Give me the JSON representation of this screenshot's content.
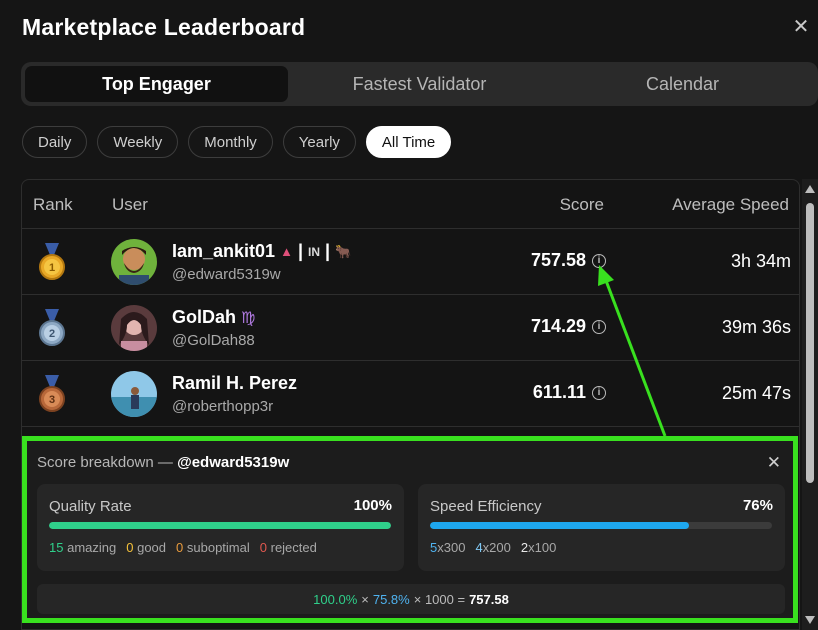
{
  "header": {
    "title": "Marketplace Leaderboard",
    "close_icon": "close-icon"
  },
  "tabs": [
    {
      "label": "Top Engager",
      "active": true
    },
    {
      "label": "Fastest Validator",
      "active": false
    },
    {
      "label": "Calendar",
      "active": false
    }
  ],
  "periods": [
    {
      "label": "Daily",
      "active": false
    },
    {
      "label": "Weekly",
      "active": false
    },
    {
      "label": "Monthly",
      "active": false
    },
    {
      "label": "Yearly",
      "active": false
    },
    {
      "label": "All Time",
      "active": true
    }
  ],
  "table": {
    "headers": {
      "rank": "Rank",
      "user": "User",
      "score": "Score",
      "speed": "Average Speed"
    },
    "rows": [
      {
        "rank": 1,
        "medal": "gold-medal",
        "name": "Iam_ankit01",
        "extra": "▲ | IN | 🐂",
        "handle": "@edward5319w",
        "score": "757.58",
        "speed": "3h 34m"
      },
      {
        "rank": 2,
        "medal": "silver-medal",
        "name": "GolDah",
        "extra": "♍",
        "handle": "@GolDah88",
        "score": "714.29",
        "speed": "39m 36s"
      },
      {
        "rank": 3,
        "medal": "bronze-medal",
        "name": "Ramil H. Perez",
        "extra": "",
        "handle": "@roberthopp3r",
        "score": "611.11",
        "speed": "25m 47s"
      }
    ]
  },
  "breakdown": {
    "title_prefix": "Score breakdown —",
    "user": "@edward5319w",
    "quality": {
      "label": "Quality Rate",
      "value": "100%",
      "fraction": 1.0,
      "color": "#2fcf8a",
      "stats": [
        {
          "num": "15",
          "label": "amazing"
        },
        {
          "num": "0",
          "label": "good"
        },
        {
          "num": "0",
          "label": "suboptimal"
        },
        {
          "num": "0",
          "label": "rejected"
        }
      ]
    },
    "speed": {
      "label": "Speed Efficiency",
      "value": "76%",
      "fraction": 0.758,
      "color": "#1ea7ef",
      "stats": [
        {
          "num": "5",
          "label": "x300"
        },
        {
          "num": "4",
          "label": "x200"
        },
        {
          "num": "2",
          "label": "x100"
        }
      ]
    },
    "formula": {
      "q": "100.0%",
      "x1": "×",
      "s": "75.8%",
      "x2": "× 1000 =",
      "result": "757.58"
    }
  }
}
